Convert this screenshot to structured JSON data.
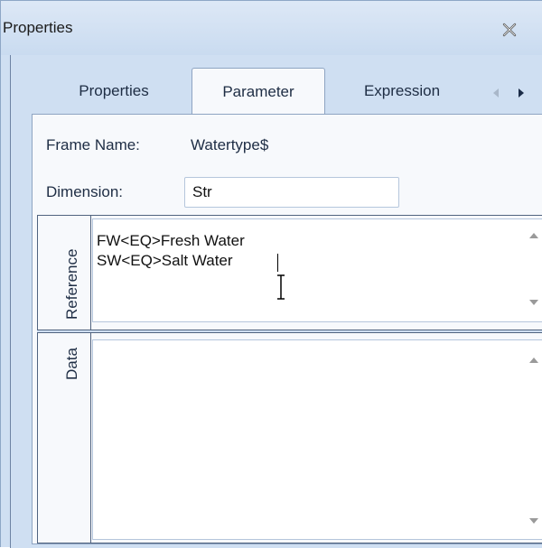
{
  "window": {
    "title": "Properties",
    "close_icon": "close-x-icon"
  },
  "tabs": [
    {
      "label": "Properties",
      "active": false
    },
    {
      "label": "Parameter",
      "active": true
    },
    {
      "label": "Expression",
      "active": false
    }
  ],
  "tab_scroll": {
    "left_icon": "triangle-left-icon",
    "right_icon": "triangle-right-icon"
  },
  "form": {
    "frame_name_label": "Frame Name:",
    "frame_name_value": "Watertype$",
    "dimension_label": "Dimension:",
    "dimension_value": "Str"
  },
  "reference": {
    "label": "Reference",
    "lines": [
      "FW<EQ>Fresh Water",
      "SW<EQ>Salt Water"
    ]
  },
  "data_section": {
    "label": "Data",
    "lines": []
  },
  "colors": {
    "panel_bg": "#cfdff2",
    "content_bg": "#f7f9fc",
    "text": "#1e2d44"
  }
}
